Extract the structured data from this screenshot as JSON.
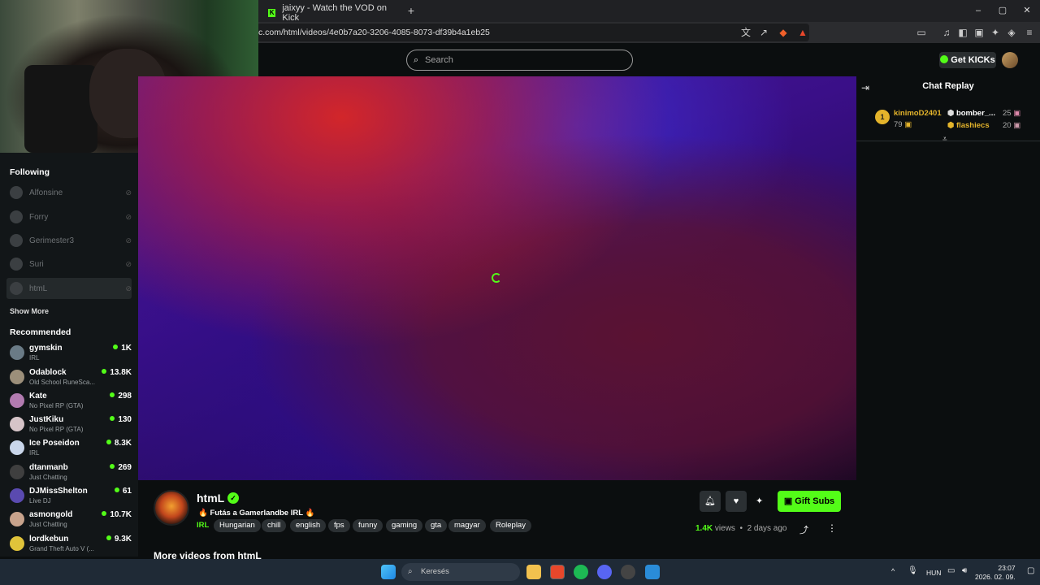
{
  "browser": {
    "tab_title": "jaixyy - Watch the VOD on Kick",
    "url": "c.com/html/videos/4e0b7a20-3206-4085-8073-df39b4a1eb25",
    "new_tab": "+",
    "min": "–",
    "max": "▢",
    "close": "✕"
  },
  "header": {
    "search_placeholder": "Search",
    "get_kicks_label": "Get KICKs"
  },
  "sidebar": {
    "following_title": "Following",
    "following": [
      {
        "name": "Alfonsine"
      },
      {
        "name": "Forry"
      },
      {
        "name": "Gerimester3"
      },
      {
        "name": "Suri"
      },
      {
        "name": "htmL"
      }
    ],
    "show_more": "Show More",
    "recommended_title": "Recommended",
    "recommended": [
      {
        "name": "gymskin",
        "category": "IRL",
        "viewers": "1K",
        "color": "#6a7b86"
      },
      {
        "name": "Odablock",
        "category": "Old School RuneSca...",
        "viewers": "13.8K",
        "color": "#9c8f7a"
      },
      {
        "name": "Kate",
        "category": "No Pixel RP (GTA)",
        "viewers": "298",
        "color": "#b27bb0"
      },
      {
        "name": "JustKiku",
        "category": "No Pixel RP (GTA)",
        "viewers": "130",
        "color": "#d6c4c8"
      },
      {
        "name": "Ice Poseidon",
        "category": "IRL",
        "viewers": "8.3K",
        "color": "#c9d6ea"
      },
      {
        "name": "dtanmanb",
        "category": "Just Chatting",
        "viewers": "269",
        "color": "#3f3f3f"
      },
      {
        "name": "DJMissShelton",
        "category": "Live DJ",
        "viewers": "61",
        "color": "#5a4ab0"
      },
      {
        "name": "asmongold",
        "category": "Just Chatting",
        "viewers": "10.7K",
        "color": "#c8a38c"
      },
      {
        "name": "lordkebun",
        "category": "Grand Theft Auto V (...",
        "viewers": "9.3K",
        "color": "#e0c33a"
      }
    ]
  },
  "chat": {
    "title": "Chat Replay",
    "leader_rank": "1",
    "leaders": [
      {
        "name": "kinimoD2401",
        "count": "79"
      },
      {
        "name": "bomber_...",
        "count": "25"
      },
      {
        "name": "flashiecs",
        "count": "20"
      }
    ]
  },
  "stream": {
    "channel": "htmL",
    "title": "🔥 Futás a Gamerlandbe IRL 🔥",
    "category": "IRL",
    "tags": [
      "Hungarian",
      "chill",
      "english",
      "fps",
      "funny",
      "gaming",
      "gta",
      "magyar",
      "Roleplay"
    ],
    "gift_subs": "Gift Subs",
    "views_count": "1.4K",
    "views_label": "views",
    "separator": "•",
    "age": "2 days ago",
    "more_videos": "More videos from htmL"
  },
  "taskbar": {
    "search_label": "Keresés",
    "language": "HUN",
    "time": "23:07",
    "date": "2026. 02. 09."
  },
  "colors": {
    "accent": "#53fc18"
  }
}
